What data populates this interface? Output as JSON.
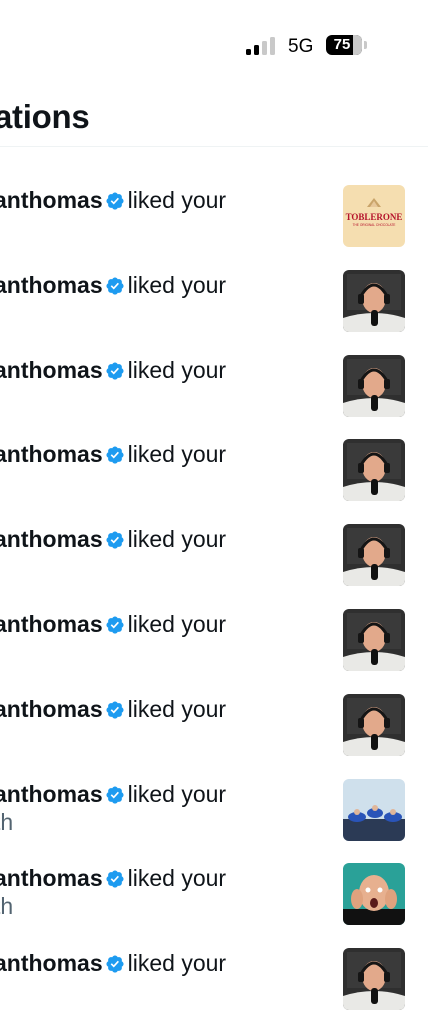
{
  "status_bar": {
    "network": "5G",
    "battery": "75"
  },
  "header": {
    "title": "ations"
  },
  "notifications": [
    {
      "username": "anthomas",
      "action": "liked your",
      "subtext": "",
      "thumb": "toblerone",
      "thumb_text": "TOBLERONE",
      "thumb_subtext": "THE ORIGINAL CHOCOLATE"
    },
    {
      "username": "anthomas",
      "action": "liked your",
      "subtext": "",
      "thumb": "podcast"
    },
    {
      "username": "anthomas",
      "action": "liked your",
      "subtext": "",
      "thumb": "podcast"
    },
    {
      "username": "anthomas",
      "action": "liked your",
      "subtext": "",
      "thumb": "podcast"
    },
    {
      "username": "anthomas",
      "action": "liked your",
      "subtext": "",
      "thumb": "podcast"
    },
    {
      "username": "anthomas",
      "action": "liked your",
      "subtext": "",
      "thumb": "podcast"
    },
    {
      "username": "anthomas",
      "action": "liked your",
      "subtext": "",
      "thumb": "podcast"
    },
    {
      "username": "anthomas",
      "action": "liked your",
      "subtext": "th",
      "thumb": "skydive"
    },
    {
      "username": "anthomas",
      "action": "liked your",
      "subtext": "th",
      "thumb": "surprised"
    },
    {
      "username": "anthomas",
      "action": "liked your",
      "subtext": "",
      "thumb": "podcast"
    }
  ],
  "colors": {
    "verified": "#1d9bf0",
    "secondary_text": "#536471",
    "divider": "#eff3f4"
  }
}
